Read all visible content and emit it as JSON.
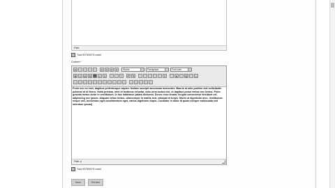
{
  "upper_editor": {
    "path_label": "Path:"
  },
  "toggle_wysiwyg_top": {
    "label": "Toss WYSIWYG moful"
  },
  "content": {
    "label": "Content:*"
  },
  "editor": {
    "format_select": "Styles",
    "paragraph_select": "Paragraph",
    "font_select": "Font size",
    "body_text": "Proin nec mi eset, dagibus pellentesque sapien. Nullam suscipit accumsan memorbis. Mauris id odio portitor nisl sollicitudin pulvinar at id libero. Nulla pretium, mtel et fustimus veluetar, odio urna luctus nisl, et dapibus purus metus nec lectus. Proin gravida metus dolor in vestibulum. In hac habitasse platea dictumst. Donec eros tenant, feugiat consectetur tincidunt vel, adipiscing nec ipsum. Aliquam tellus lectus, ullamcorper in mattis sed, volutpat et turpis. Morbi ut dignissim arcu. Vestibulum neque orci, accumsan eget condimentum eget, varius dignissim turpis. Curabitur in dolor id quam semper malesuada sed interdum ipsum]",
    "path_label": "Path: p"
  },
  "toggle_wysiwyg_bottom": {
    "label": "Toss WYSIWYG moful"
  },
  "buttons": {
    "save": "Save",
    "preview": "Preview"
  }
}
